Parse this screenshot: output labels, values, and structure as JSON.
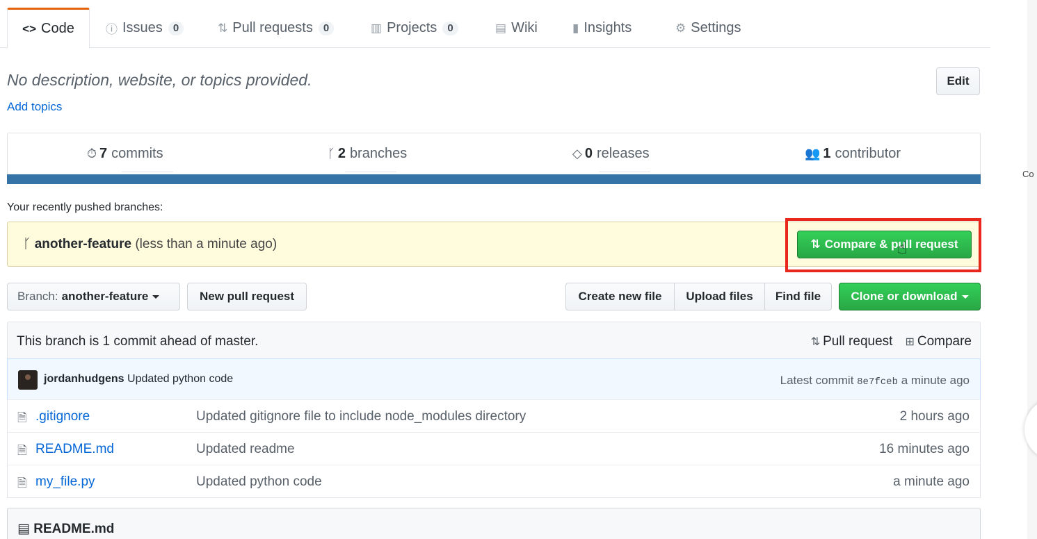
{
  "tabs": [
    {
      "label": "Code",
      "icon": "code-icon",
      "glyph": "<>",
      "counter": null,
      "selected": true
    },
    {
      "label": "Issues",
      "icon": "issue-icon",
      "glyph": "ⓘ",
      "counter": "0"
    },
    {
      "label": "Pull requests",
      "icon": "pull-request-icon",
      "glyph": "⇅",
      "counter": "0"
    },
    {
      "label": "Projects",
      "icon": "project-icon",
      "glyph": "▥",
      "counter": "0"
    },
    {
      "label": "Wiki",
      "icon": "book-icon",
      "glyph": "▤",
      "counter": null
    },
    {
      "label": "Insights",
      "icon": "graph-icon",
      "glyph": "▮",
      "counter": null
    },
    {
      "label": "Settings",
      "icon": "gear-icon",
      "glyph": "⚙",
      "counter": null
    }
  ],
  "repo": {
    "description": "No description, website, or topics provided.",
    "add_topics": "Add topics",
    "edit_label": "Edit"
  },
  "summary": {
    "commits_count": "7",
    "commits_label": "commits",
    "branches_count": "2",
    "branches_label": "branches",
    "releases_count": "0",
    "releases_label": "releases",
    "contributors_count": "1",
    "contributors_label": "contributor",
    "language_color": "#3572a5"
  },
  "recent": {
    "label": "Your recently pushed branches:",
    "branch": "another-feature",
    "time": "(less than a minute ago)",
    "compare_label": "Compare & pull request"
  },
  "file_nav": {
    "branch_prefix": "Branch:",
    "branch_name": "another-feature",
    "new_pr": "New pull request",
    "create_file": "Create new file",
    "upload_files": "Upload files",
    "find_file": "Find file",
    "clone": "Clone or download"
  },
  "branch_info": {
    "message": "This branch is 1 commit ahead of master.",
    "pull_request": "Pull request",
    "compare": "Compare"
  },
  "commit": {
    "author": "jordanhudgens",
    "message": "Updated python code",
    "latest_label": "Latest commit",
    "sha": "8e7fceb",
    "age": "a minute ago"
  },
  "files": [
    {
      "name": ".gitignore",
      "message": "Updated gitignore file to include node_modules directory",
      "age": "2 hours ago"
    },
    {
      "name": "README.md",
      "message": "Updated readme",
      "age": "16 minutes ago"
    },
    {
      "name": "my_file.py",
      "message": "Updated python code",
      "age": "a minute ago"
    }
  ],
  "readme": {
    "title": "README.md"
  },
  "side": {
    "text": "Co"
  }
}
